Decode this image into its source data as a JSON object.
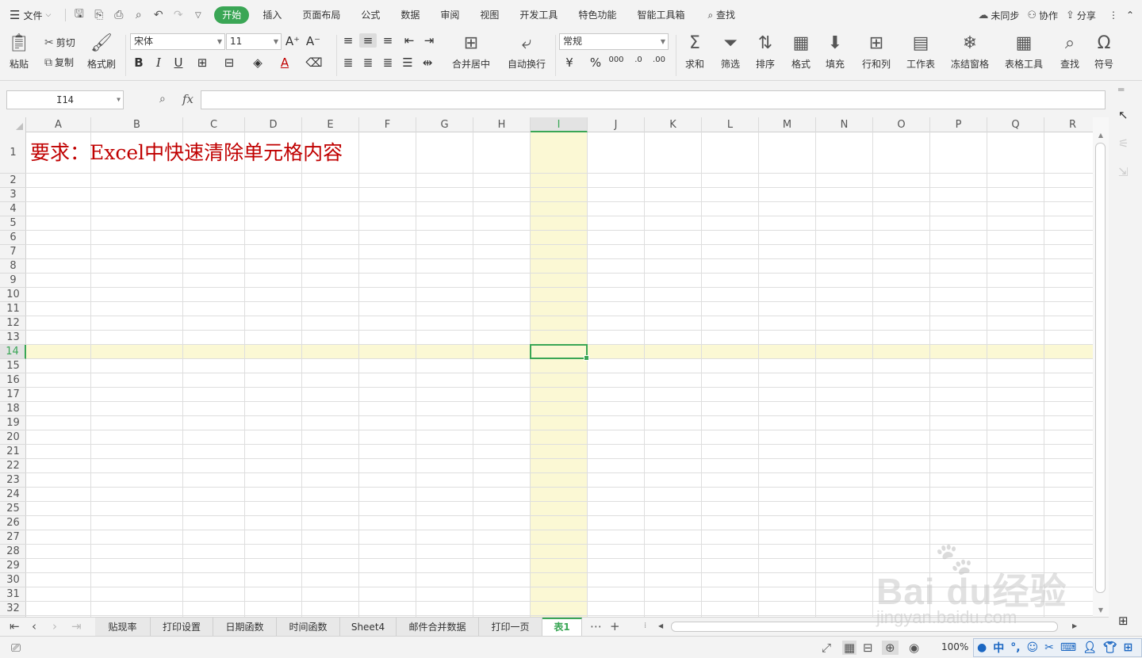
{
  "menubar": {
    "file_label": "文件",
    "tabs": [
      "开始",
      "插入",
      "页面布局",
      "公式",
      "数据",
      "审阅",
      "视图",
      "开发工具",
      "特色功能",
      "智能工具箱"
    ],
    "search_label": "查找",
    "sync_label": "未同步",
    "collab_label": "协作",
    "share_label": "分享"
  },
  "ribbon": {
    "paste": "粘贴",
    "cut": "剪切",
    "copy": "复制",
    "format_painter": "格式刷",
    "font_name": "宋体",
    "font_size": "11",
    "merge_center": "合并居中",
    "wrap_text": "自动换行",
    "number_format": "常规",
    "sum": "求和",
    "filter": "筛选",
    "sort": "排序",
    "format": "格式",
    "fill": "填充",
    "row_col": "行和列",
    "worksheet": "工作表",
    "freeze": "冻结窗格",
    "table_tools": "表格工具",
    "find": "查找",
    "symbol": "符号"
  },
  "formula_bar": {
    "name_box": "I14",
    "fx": "fx",
    "content": ""
  },
  "grid": {
    "columns": [
      "A",
      "B",
      "C",
      "D",
      "E",
      "F",
      "G",
      "H",
      "I",
      "J",
      "K",
      "L",
      "M",
      "N",
      "O",
      "P",
      "Q",
      "R"
    ],
    "rows": [
      "1",
      "2",
      "3",
      "4",
      "5",
      "6",
      "7",
      "8",
      "9",
      "10",
      "11",
      "12",
      "13",
      "14",
      "15",
      "16",
      "17",
      "18",
      "19",
      "20",
      "21",
      "22",
      "23",
      "24",
      "25",
      "26",
      "27",
      "28",
      "29",
      "30",
      "31",
      "32"
    ],
    "selected_column": "I",
    "selected_row": "14",
    "a1_text": "要求：Excel中快速清除单元格内容",
    "a1_color": "#c00000"
  },
  "sheets": {
    "tabs": [
      "贴现率",
      "打印设置",
      "日期函数",
      "时间函数",
      "Sheet4",
      "邮件合并数据",
      "打印一页",
      "表1"
    ],
    "active": "表1",
    "more": "⋯",
    "add": "+"
  },
  "status": {
    "zoom": "100%",
    "ime_label": "中"
  },
  "watermark": {
    "brand": "Bai du经验",
    "url": "jingyan.baidu.com"
  },
  "colors": {
    "accent": "#3aa655",
    "highlight": "#fbf8d4",
    "chrome": "#f3f3f3"
  }
}
